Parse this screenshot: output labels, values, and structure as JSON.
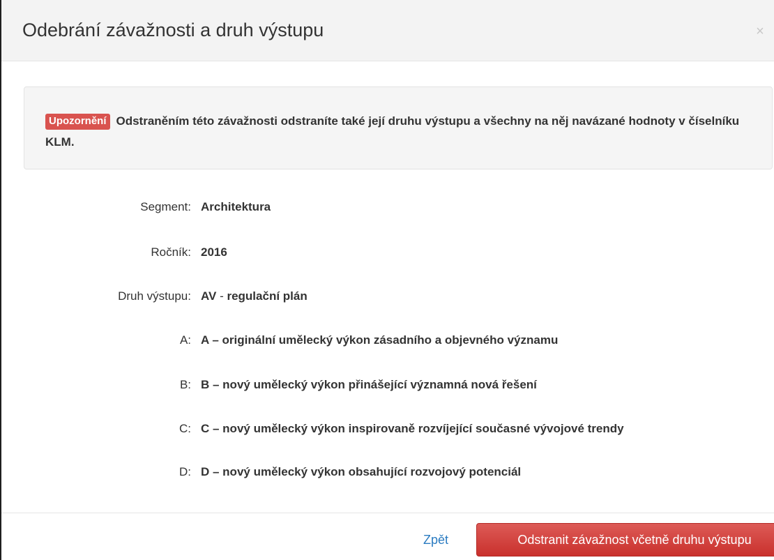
{
  "modal": {
    "title": "Odebrání závažnosti a druh výstupu",
    "close_icon": "×"
  },
  "warning": {
    "badge": "Upozornění",
    "text": "Odstraněním této závažnosti odstraníte také její druhu výstupu a všechny na něj navázané hodnoty v číselníku KLM."
  },
  "fields": {
    "segment": {
      "label": "Segment:",
      "value": "Architektura"
    },
    "rocnik": {
      "label": "Ročník:",
      "value": "2016"
    },
    "druh": {
      "label": "Druh výstupu:",
      "code": "AV",
      "separator": " - ",
      "value": "regulační plán"
    },
    "a": {
      "label": "A:",
      "value": "A – originální umělecký výkon zásadního a objevného významu"
    },
    "b": {
      "label": "B:",
      "value": "B – nový umělecký výkon přinášející významná nová řešení"
    },
    "c": {
      "label": "C:",
      "value": "C – nový umělecký výkon inspirovaně rozvíjející současné vývojové trendy"
    },
    "d": {
      "label": "D:",
      "value": "D – nový umělecký výkon obsahující rozvojový potenciál"
    }
  },
  "footer": {
    "back_label": "Zpět",
    "delete_label": "Odstranit závažnost včetně druhu výstupu"
  },
  "colors": {
    "danger": "#d9534f",
    "link": "#2a7bc1",
    "header_bg": "#f3f3f3",
    "well_bg": "#f5f5f5"
  }
}
